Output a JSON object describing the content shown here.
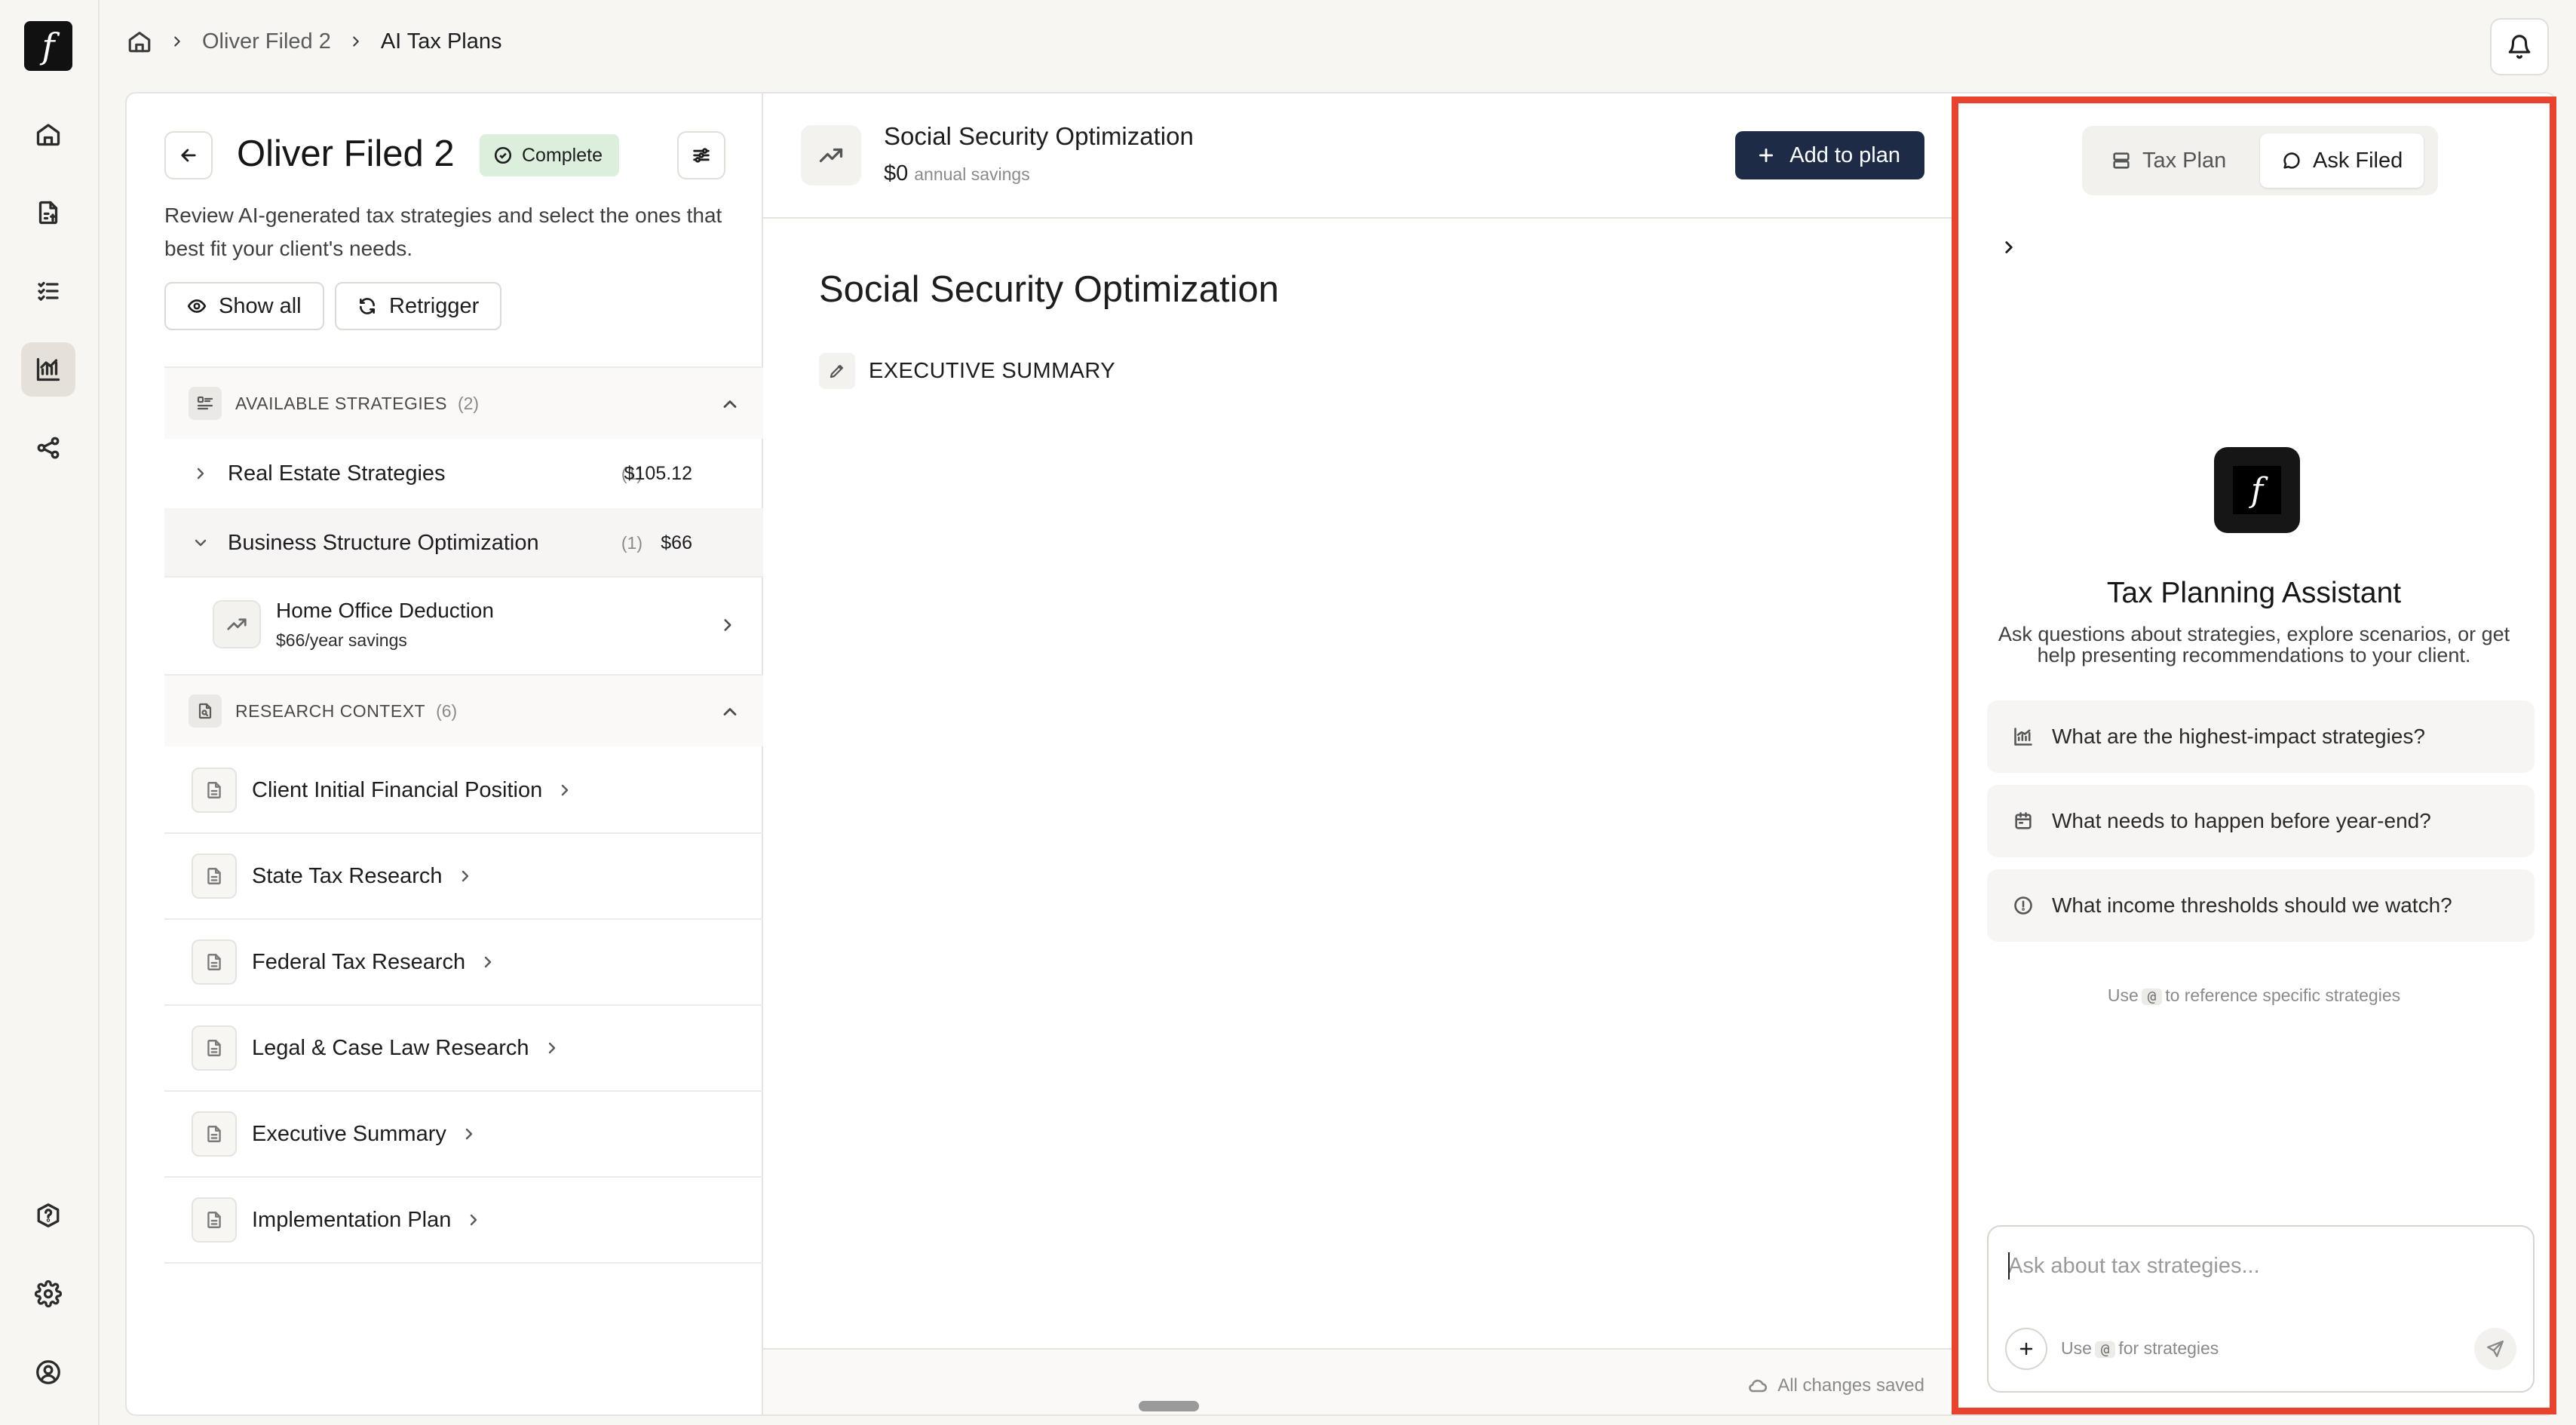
{
  "app": {
    "logo_glyph": "f"
  },
  "rail": {
    "items": [
      "home-icon",
      "document-dollar-icon",
      "checklist-icon",
      "chart-icon",
      "share-icon"
    ],
    "bottom": [
      "help-icon",
      "settings-icon",
      "user-icon"
    ],
    "active": "chart-icon"
  },
  "breadcrumb": {
    "items": [
      "Oliver Filed 2",
      "AI Tax Plans"
    ]
  },
  "strategies_panel": {
    "title": "Oliver Filed 2",
    "status": "Complete",
    "description": "Review AI-generated tax strategies and select the ones that best fit your client's needs.",
    "show_all_label": "Show all",
    "retrigger_label": "Retrigger",
    "available": {
      "label": "AVAILABLE STRATEGIES",
      "count": "(2)",
      "categories": [
        {
          "name": "Real Estate Strategies",
          "count": "(1)",
          "amount": "$105.12",
          "expanded": false
        },
        {
          "name": "Business Structure Optimization",
          "count": "(1)",
          "amount": "$66",
          "expanded": true
        }
      ],
      "strategy": {
        "title": "Home Office Deduction",
        "savings": "$66/year savings"
      }
    },
    "research": {
      "label": "RESEARCH CONTEXT",
      "count": "(6)",
      "items": [
        "Client Initial Financial Position",
        "State Tax Research",
        "Federal Tax Research",
        "Legal & Case Law Research",
        "Executive Summary",
        "Implementation Plan"
      ]
    }
  },
  "detail": {
    "header_title": "Social Security Optimization",
    "amount": "$0",
    "amount_sub": "annual savings",
    "add_button": "Add to plan",
    "title": "Social Security Optimization",
    "section": "EXECUTIVE SUMMARY",
    "saved_status": "All changes saved"
  },
  "assistant": {
    "tabs": [
      {
        "label": "Tax Plan",
        "active": false
      },
      {
        "label": "Ask Filed",
        "active": true
      }
    ],
    "title": "Tax Planning Assistant",
    "description": "Ask questions about strategies, explore scenarios, or get help presenting recommendations to your client.",
    "suggestions": [
      "What are the highest-impact strategies?",
      "What needs to happen before year-end?",
      "What income thresholds should we watch?"
    ],
    "hint_prefix": "Use",
    "hint_key": "@",
    "hint_suffix": "to reference specific strategies",
    "input_placeholder": "Ask about tax strategies...",
    "composer_hint_prefix": "Use",
    "composer_hint_key": "@",
    "composer_hint_suffix": "for strategies",
    "highlight_color": "#e8432e"
  }
}
